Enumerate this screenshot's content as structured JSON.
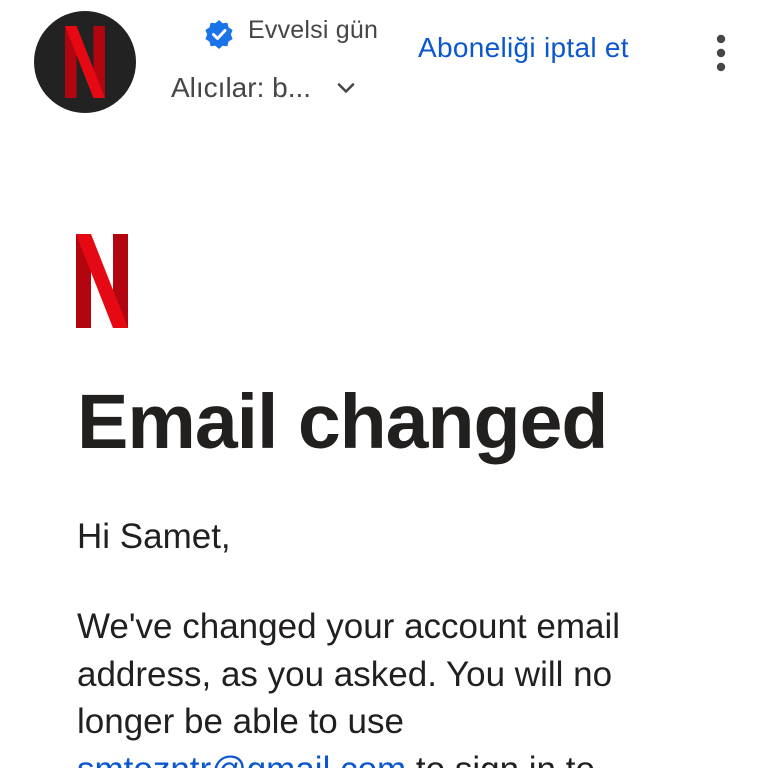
{
  "header": {
    "sender_name": "Netflix",
    "sent_time": "Evvelsi gün",
    "recipients_label": "Alıcılar: b...",
    "unsubscribe_label": "Aboneliği iptal et",
    "verified": true
  },
  "body": {
    "brand": "Netflix",
    "heading": "Email changed",
    "greeting": "Hi Samet,",
    "message_lines": [
      "We've changed your account email",
      "address, as you asked. You will no",
      "longer be able to use"
    ],
    "old_email": "smtozntr@gmail.com",
    "message_tail": " to sign in to"
  },
  "colors": {
    "brand_red": "#e50914",
    "link_blue": "#0b57d0",
    "verified_blue": "#1a73e8",
    "avatar_bg": "#222222"
  },
  "icons": {
    "verified": "verified-check-icon",
    "chevron": "chevron-down-icon",
    "more": "more-vert-icon",
    "logo": "netflix-logo"
  }
}
